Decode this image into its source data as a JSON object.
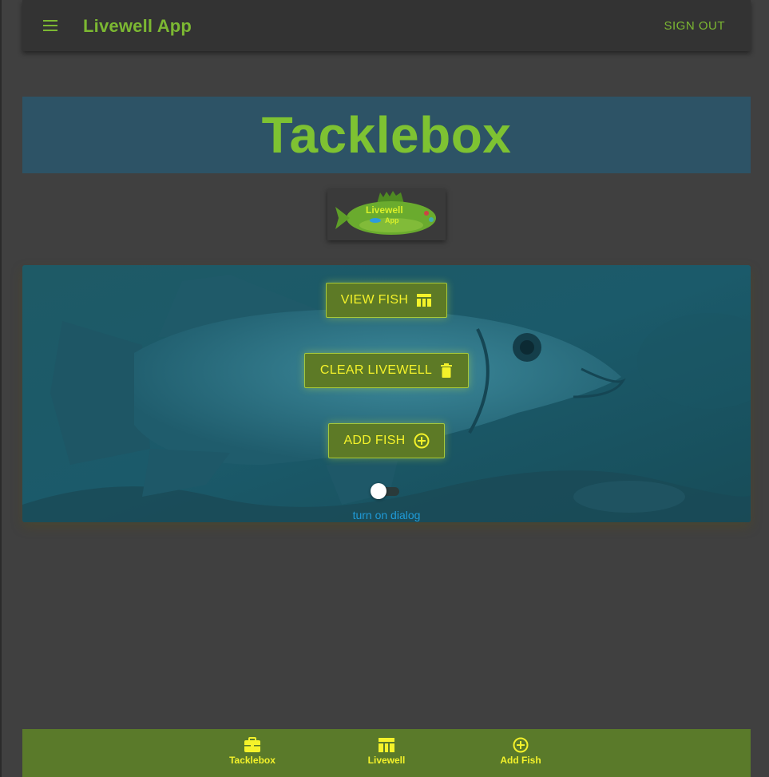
{
  "appbar": {
    "title": "Livewell App",
    "signout_label": "SIGN OUT"
  },
  "page": {
    "title": "Tacklebox",
    "logo_text_line1": "Livewell",
    "logo_text_line2": "App"
  },
  "actions": {
    "view_fish": "VIEW FISH",
    "clear_livewell": "CLEAR LIVEWELL",
    "add_fish": "ADD FISH"
  },
  "toggle": {
    "label": "turn on dialog",
    "checked": false
  },
  "bottom_nav": {
    "items": [
      {
        "label": "Tacklebox",
        "icon": "briefcase-icon"
      },
      {
        "label": "Livewell",
        "icon": "table-icon"
      },
      {
        "label": "Add Fish",
        "icon": "add-circle-icon"
      }
    ]
  },
  "colors": {
    "accent_green": "#7cb832",
    "button_text_yellow": "#f4f22a",
    "link_blue": "#1f9bd8",
    "banner_teal": "#2d5366",
    "nav_green": "#5a7a2a"
  }
}
